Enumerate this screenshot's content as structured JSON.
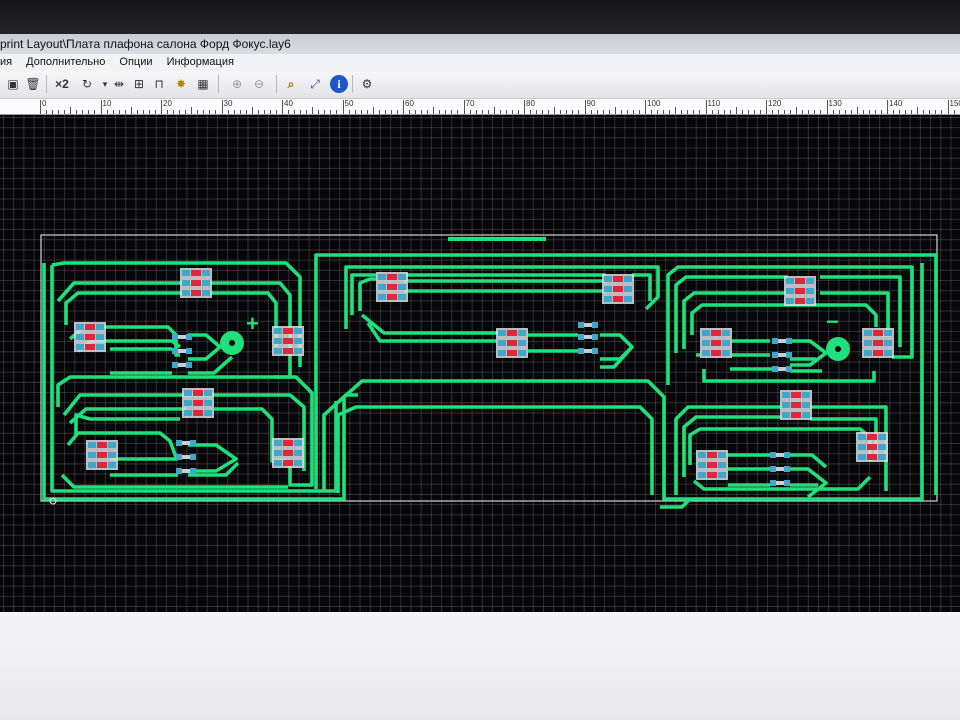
{
  "window": {
    "title": "print Layout\\Плата плафона салона Форд Фокус.lay6"
  },
  "menu": {
    "items": [
      "ия",
      "Дополнительно",
      "Опции",
      "Информация"
    ]
  },
  "toolbar": {
    "zoom_label": "×2",
    "icons": [
      "save-icon",
      "trash-icon",
      "zoom-x2-icon",
      "rotate-icon",
      "mirror-icon",
      "align-icon",
      "component-icon",
      "light-icon",
      "grid-icon",
      "lock-icon",
      "unlock-icon",
      "magnifier-icon",
      "transform-icon",
      "info-icon",
      "settings-icon"
    ]
  },
  "ruler": {
    "labels": [
      "0",
      "10",
      "20",
      "30",
      "40",
      "50",
      "60",
      "70",
      "80",
      "90",
      "100",
      "110",
      "120",
      "130",
      "140",
      "150"
    ]
  },
  "board": {
    "plus_marker": "+",
    "minus_marker": "−",
    "colors": {
      "trace": "#1fe07a",
      "pad": "#3fa7c8",
      "smd_body": "#e0263a",
      "grid": "#808088",
      "background": "#07070a"
    }
  }
}
